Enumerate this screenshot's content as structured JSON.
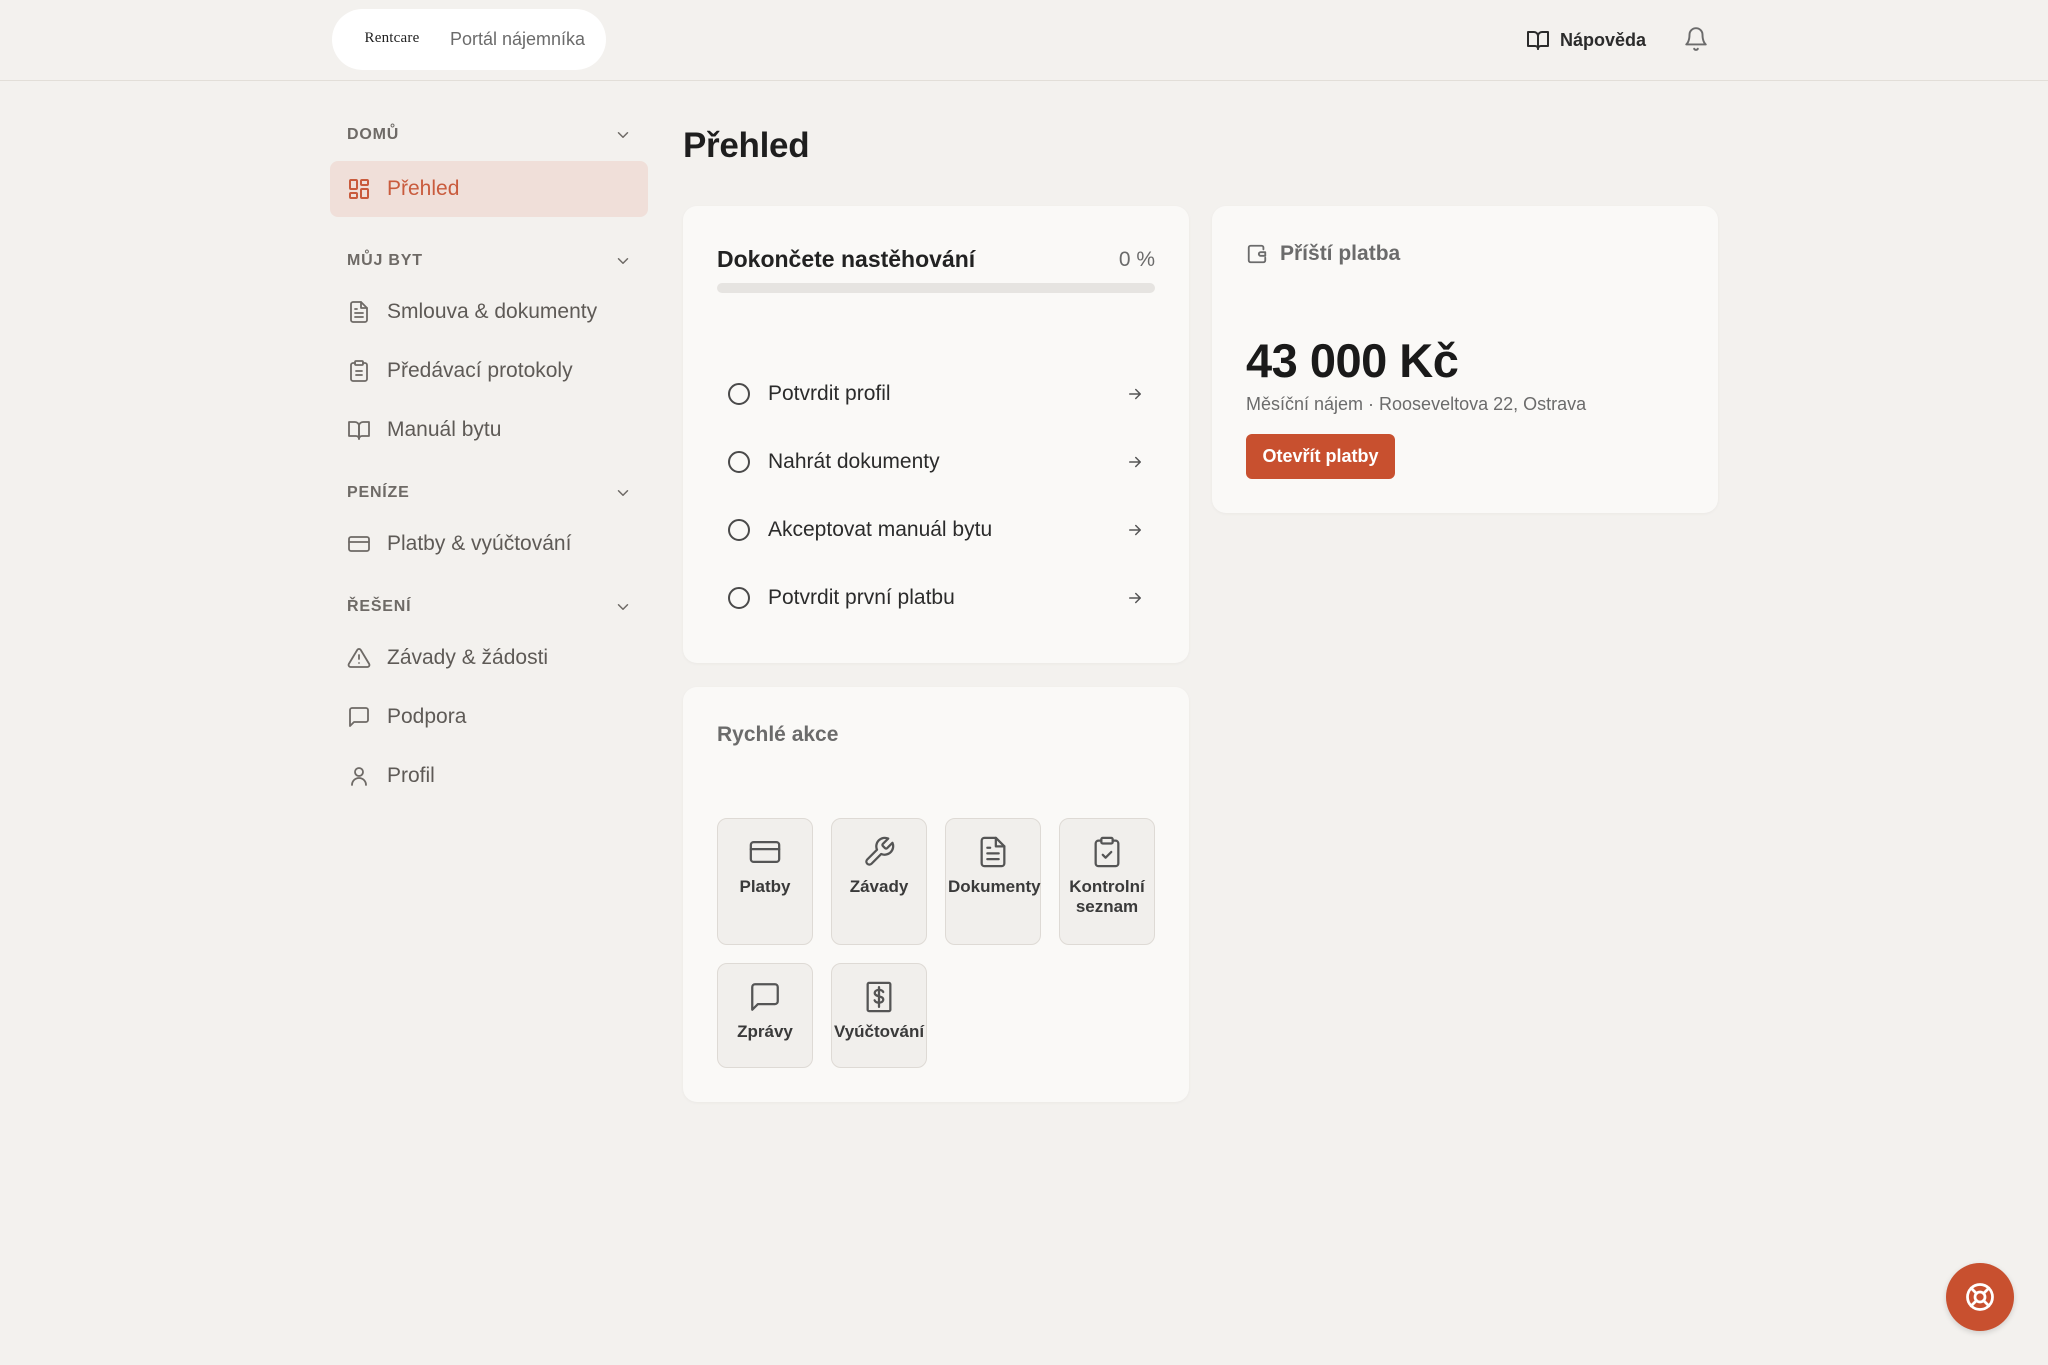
{
  "header": {
    "logo_text": "Rentcare",
    "logo_tagline": "",
    "portal_name": "Portál nájemníka",
    "help_label": "Nápověda",
    "help_icon": "book-open-icon",
    "notifications_icon": "bell-icon"
  },
  "sidebar": {
    "sections": [
      {
        "title": "DOMŮ",
        "items": [
          {
            "label": "Přehled",
            "icon": "dashboard-grid-icon",
            "active": true
          }
        ]
      },
      {
        "title": "MŮJ BYT",
        "items": [
          {
            "label": "Smlouva & dokumenty",
            "icon": "file-text-icon"
          },
          {
            "label": "Předávací protokoly",
            "icon": "clipboard-icon"
          },
          {
            "label": "Manuál bytu",
            "icon": "book-open-icon"
          }
        ]
      },
      {
        "title": "PENÍZE",
        "items": [
          {
            "label": "Platby & vyúčtování",
            "icon": "credit-card-icon"
          }
        ]
      },
      {
        "title": "ŘEŠENÍ",
        "items": [
          {
            "label": "Závady & žádosti",
            "icon": "warning-triangle-icon"
          },
          {
            "label": "Podpora",
            "icon": "message-square-icon"
          },
          {
            "label": "Profil",
            "icon": "user-icon"
          }
        ]
      }
    ]
  },
  "main": {
    "title": "Přehled",
    "onboarding": {
      "title": "Dokončete nastěhování",
      "progress_label": "0 %",
      "progress_value": 0,
      "tasks": [
        {
          "label": "Potvrdit profil"
        },
        {
          "label": "Nahrát dokumenty"
        },
        {
          "label": "Akceptovat manuál bytu"
        },
        {
          "label": "Potvrdit první platbu"
        }
      ]
    },
    "next_payment": {
      "title": "Příští platba",
      "icon": "wallet-icon",
      "amount": "43 000 Kč",
      "subtitle": "Měsíční nájem · Rooseveltova 22, Ostrava",
      "button_label": "Otevřít platby"
    },
    "quick_actions": {
      "title": "Rychlé akce",
      "tiles": [
        {
          "label": "Platby",
          "icon": "credit-card-icon"
        },
        {
          "label": "Závady",
          "icon": "wrench-icon"
        },
        {
          "label": "Dokumenty",
          "icon": "file-text-icon"
        },
        {
          "label": "Kontrolní seznam",
          "icon": "clipboard-check-icon"
        },
        {
          "label": "Zprávy",
          "icon": "message-square-icon"
        },
        {
          "label": "Vyúčtování",
          "icon": "receipt-dollar-icon"
        }
      ]
    }
  },
  "support_fab": {
    "icon": "lifebuoy-icon"
  },
  "colors": {
    "accent": "#c8502f",
    "background": "#f3f1ee",
    "card": "#faf9f7",
    "active_nav_bg": "#f0dfd9"
  }
}
